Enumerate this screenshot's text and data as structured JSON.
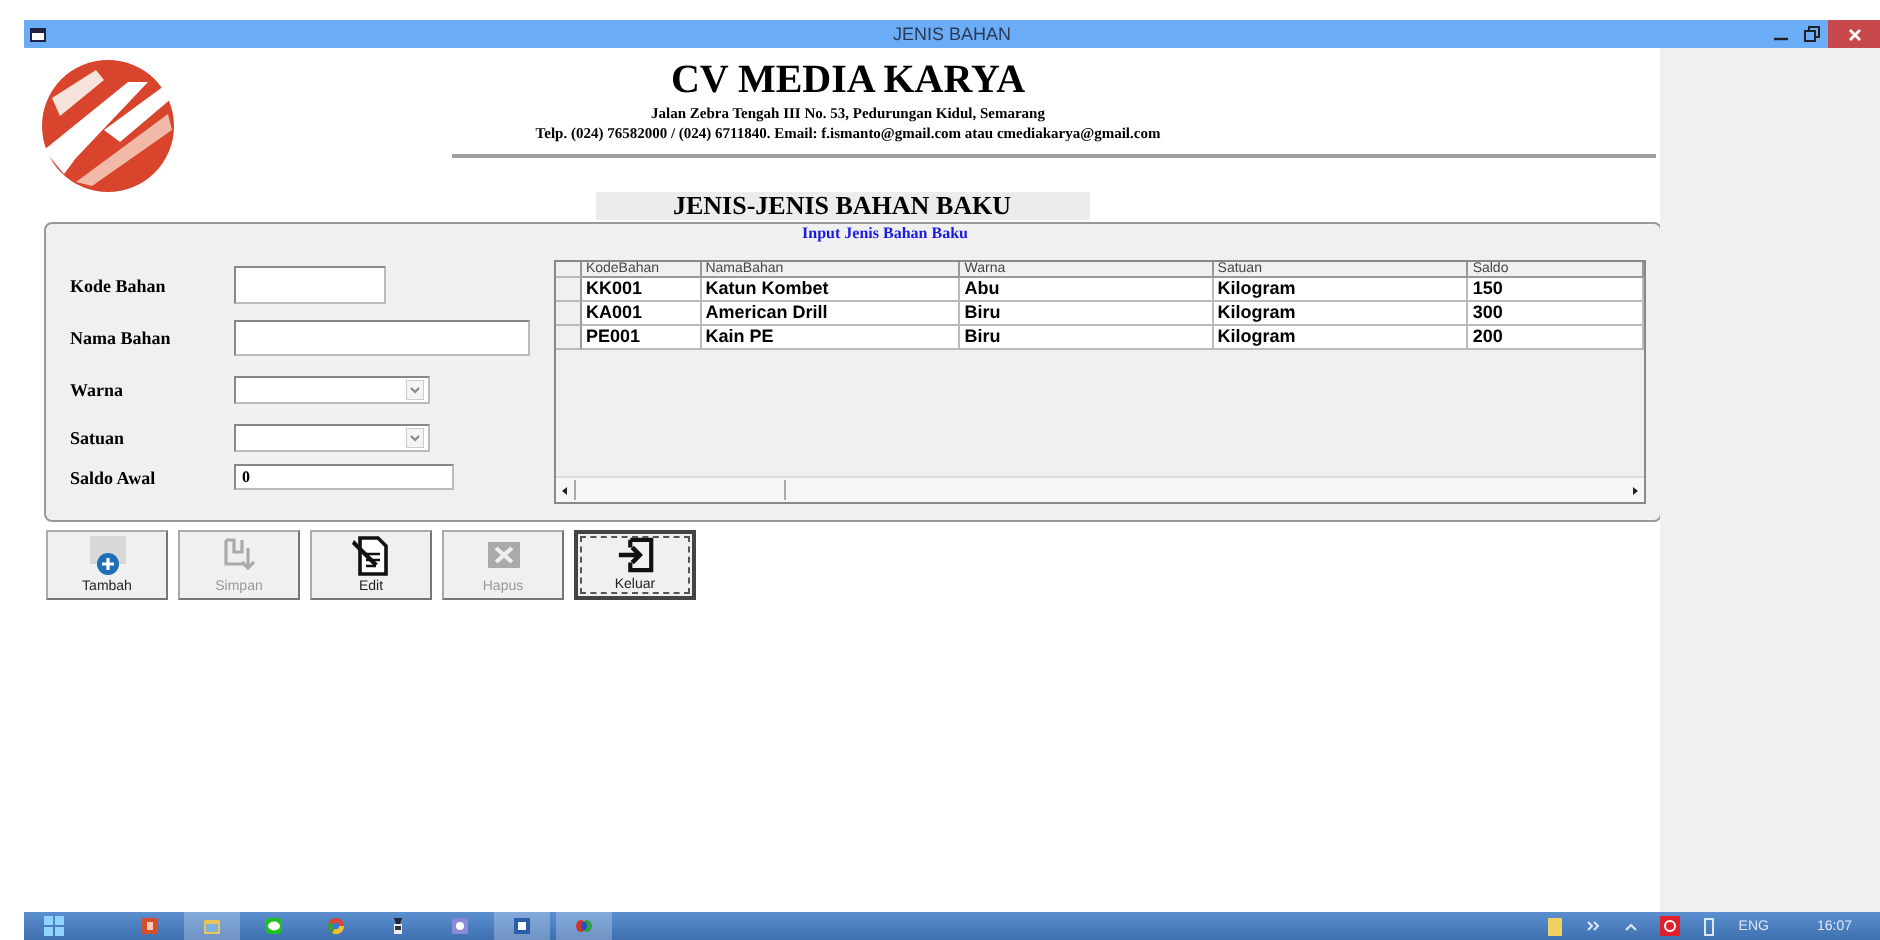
{
  "window": {
    "title": "JENIS BAHAN"
  },
  "header": {
    "company": "CV MEDIA KARYA",
    "address": "Jalan Zebra Tengah III No. 53, Pedurungan Kidul, Semarang",
    "contact": "Telp. (024) 76582000 / (024) 6711840. Email: f.ismanto@gmail.com atau cmediakarya@gmail.com"
  },
  "section": {
    "title": "JENIS-JENIS BAHAN BAKU",
    "subtitle": "Input Jenis Bahan Baku"
  },
  "form": {
    "fields": [
      {
        "label": "Kode Bahan",
        "kind": "text"
      },
      {
        "label": "Nama Bahan",
        "kind": "text"
      },
      {
        "label": "Warna",
        "kind": "combo"
      },
      {
        "label": "Satuan",
        "kind": "combo"
      },
      {
        "label": "Saldo Awal",
        "kind": "text",
        "value": "0"
      }
    ]
  },
  "table": {
    "columns": [
      "KodeBahan",
      "NamaBahan",
      "Warna",
      "Satuan",
      "Saldo"
    ],
    "rows": [
      [
        "KK001",
        "Katun Kombet",
        "Abu",
        "Kilogram",
        "150"
      ],
      [
        "KA001",
        "American Drill",
        "Biru",
        "Kilogram",
        "300"
      ],
      [
        "PE001",
        "Kain PE",
        "Biru",
        "Kilogram",
        "200"
      ]
    ]
  },
  "buttons": [
    {
      "label": "Tambah",
      "kind": "add",
      "disabled": false,
      "focused": false
    },
    {
      "label": "Simpan",
      "kind": "save",
      "disabled": true,
      "focused": false
    },
    {
      "label": "Edit",
      "kind": "edit",
      "disabled": false,
      "focused": false
    },
    {
      "label": "Hapus",
      "kind": "delete",
      "disabled": true,
      "focused": false
    },
    {
      "label": "Keluar",
      "kind": "exit",
      "disabled": false,
      "focused": true
    }
  ],
  "taskbar": {
    "apps": [
      {
        "kind": "slides",
        "active": false
      },
      {
        "kind": "folder",
        "active": true
      },
      {
        "kind": "chat",
        "active": false
      },
      {
        "kind": "browser",
        "active": false
      },
      {
        "kind": "tool",
        "active": false
      },
      {
        "kind": "photos",
        "active": false
      },
      {
        "kind": "document",
        "active": true
      },
      {
        "kind": "rings",
        "active": true
      }
    ],
    "language": "ENG",
    "time": "16:07"
  }
}
